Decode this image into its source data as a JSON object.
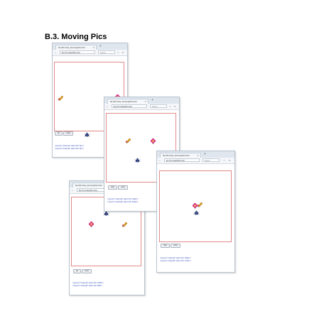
{
  "heading": "B.3. Moving Pics",
  "windows": [
    {
      "tab_title": "file:///D:/code_4/movingPics.html",
      "url": "file:///C:/code4/Pics.html",
      "search_placeholder": "Search",
      "button_go": "go",
      "button_reset": "reset",
      "code": [
        "<img src=\"cow1.gif\" style=\"left: 0px\">",
        "<img src=\"cow2.gif\" style=\"left: 0px\">"
      ]
    },
    {
      "tab_title": "file:///D:/code_4/movingPics.html",
      "url": "file:///C:/code4/Pics.html",
      "search_placeholder": "Search",
      "button_go": "stop",
      "button_reset": "reset",
      "code": [
        "<img src=\"cow1.gif\" style=\"left: 109px\">",
        "<img src=\"cow2.gif\" style=\"left: 304px\">"
      ]
    },
    {
      "tab_title": "file:///D:/code_4/movingPics.html",
      "url": "file:///C:/code4/Pics.html",
      "search_placeholder": "Search",
      "button_go": "stop",
      "button_reset": "reset",
      "code": [
        "<img src=\"cow1.gif\" style=\"left: 196px\">",
        "<img src=\"cow2.gif\" style=\"left: 176px\">"
      ]
    },
    {
      "tab_title": "file:///D:/code_4/movingPics.html",
      "url": "file:///C:/code4/Pics.html",
      "search_placeholder": "Search",
      "button_go": "go",
      "button_reset": "reset",
      "code": [
        "<img src=\"cow1.gif\" style=\"left: 143px\">",
        "<img src=\"cow2.gif\" style=\"left: 93px\">"
      ]
    }
  ],
  "icons": {
    "back": "back-arrow-icon",
    "star": "star-icon",
    "home": "home-icon",
    "menu": "menu-icon",
    "pencil": "pencil-sprite-icon",
    "flower": "flower-sprite-icon",
    "bug": "bug-sprite-icon"
  },
  "colors": {
    "stage_border": "#e28a8a",
    "code_text": "#2a44b8",
    "pencil": "#e0a020",
    "flower": "#d8368a",
    "bug": "#2b3a73"
  }
}
